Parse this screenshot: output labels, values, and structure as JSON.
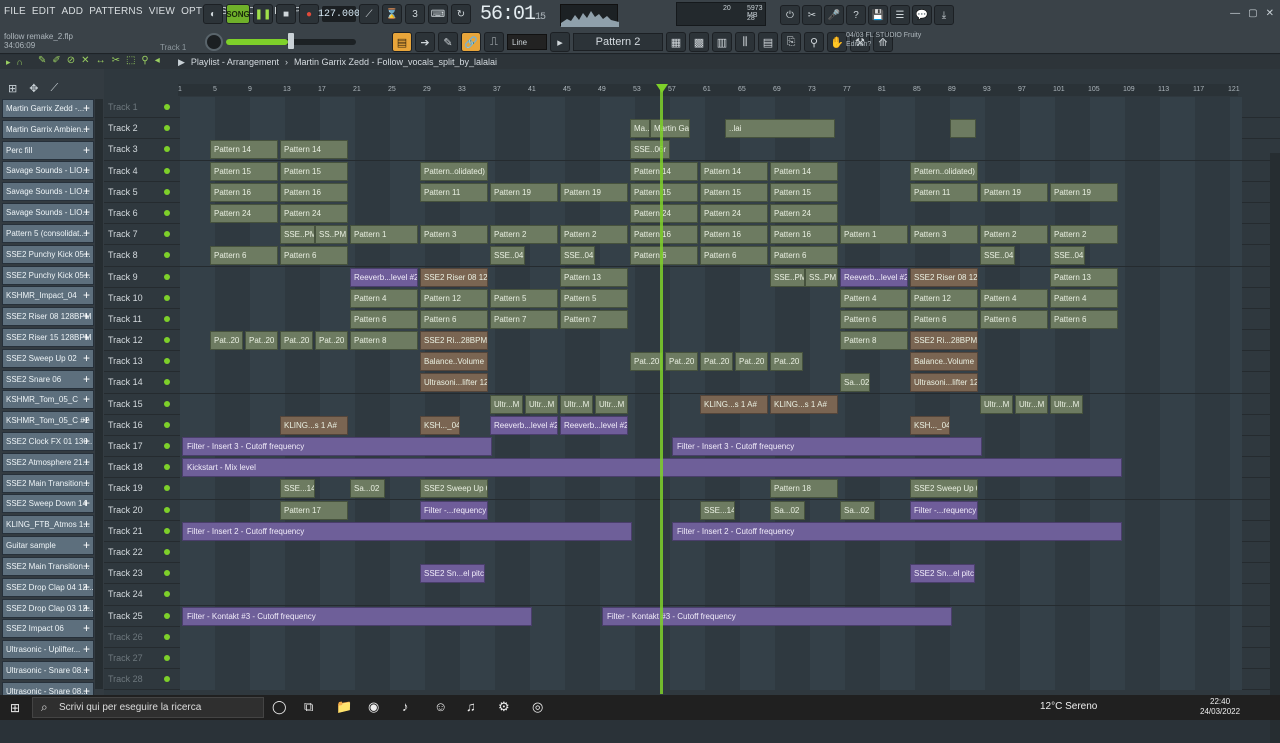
{
  "menu": [
    "FILE",
    "EDIT",
    "ADD",
    "PATTERNS",
    "VIEW",
    "OPTIONS",
    "TOOLS",
    "HELP"
  ],
  "project": {
    "file": "follow remake_2.flp",
    "time": "34:06:09",
    "track_hint": "Track 1"
  },
  "transport": {
    "song_label": "SONG",
    "tempo": "127.000",
    "clock": "56:01",
    "clock_sub": "15"
  },
  "cpu": {
    "a": "20",
    "b": "5973 MB",
    "c": "28"
  },
  "toolbar2": {
    "snap": "Line",
    "pattern": "Pattern 2"
  },
  "news": {
    "line1": "04/03  FL STUDIO Fruity",
    "line2": "Edition?"
  },
  "playlist": {
    "crumb": "Playlist - Arrangement",
    "sep": "›",
    "file": "Martin Garrix Zedd - Follow_vocals_split_by_lalalai"
  },
  "ruler": [
    "1",
    "5",
    "9",
    "13",
    "17",
    "21",
    "25",
    "29",
    "33",
    "37",
    "41",
    "45",
    "49",
    "53",
    "57",
    "61",
    "65",
    "69",
    "73",
    "77",
    "81",
    "85",
    "89",
    "93",
    "97",
    "101",
    "105",
    "109",
    "113",
    "117",
    "121"
  ],
  "channels": [
    "Martin Garrix Zedd -...",
    "Martin Garrix Ambien...",
    "Perc fill",
    "Savage Sounds - LIO...",
    "Savage Sounds - LIO...",
    "Savage Sounds - LIO...",
    "Pattern 5 (consolidat...",
    "SSE2 Punchy Kick 05...",
    "SSE2 Punchy Kick 05...",
    "KSHMR_Impact_04",
    "SSE2 Riser 08 128BPM",
    "SSE2 Riser 15 128BPM",
    "SSE2 Sweep Up 02",
    "SSE2 Snare 06",
    "KSHMR_Tom_05_C",
    "KSHMR_Tom_05_C #2",
    "SSE2 Clock FX 01 130...",
    "SSE2 Atmosphere 21...",
    "SSE2 Main Transition...",
    "SSE2 Sweep Down 14",
    "KLING_FTB_Atmos 1...",
    "Guitar sample",
    "SSE2 Main Transition...",
    "SSE2 Drop Clap 04 12...",
    "SSE2 Drop Clap 03 12...",
    "SSE2 Impact 06",
    "Ultrasonic - Uplifter...",
    "Ultrasonic - Snare 08...",
    "Ultrasonic - Snare 08..."
  ],
  "tracks": [
    "Track 1",
    "Track 2",
    "Track 3",
    "Track 4",
    "Track 5",
    "Track 6",
    "Track 7",
    "Track 8",
    "Track 9",
    "Track 10",
    "Track 11",
    "Track 12",
    "Track 13",
    "Track 14",
    "Track 15",
    "Track 16",
    "Track 17",
    "Track 18",
    "Track 19",
    "Track 20",
    "Track 21",
    "Track 22",
    "Track 23",
    "Track 24",
    "Track 25",
    "Track 26",
    "Track 27",
    "Track 28"
  ],
  "clips": {
    "t2": [
      "Ma..alalai",
      "Martin Garrix..._split_by_lalalai",
      "..lai"
    ],
    "t3": [
      "Pattern 14",
      "Pattern 14",
      "SSE..06r"
    ],
    "t4": [
      "Pattern 15",
      "Pattern 15",
      "Pattern..olidated)",
      "Pattern 14",
      "Pattern 14",
      "Pattern 14",
      "Pattern..olidated)"
    ],
    "t5": [
      "Pattern 16",
      "Pattern 16",
      "Pattern 11",
      "Pattern 19",
      "Pattern 19",
      "Pattern 15",
      "Pattern 15",
      "Pattern 15",
      "Pattern 11",
      "Pattern 19",
      "Pattern 19"
    ],
    "t6": [
      "Pattern 24",
      "Pattern 24",
      "Pattern 24",
      "Pattern 24",
      "Pattern 24"
    ],
    "t7": [
      "SSE..PM",
      "SS..PM",
      "Pattern 1",
      "Pattern 3",
      "Pattern 2",
      "Pattern 2",
      "Pattern 16",
      "Pattern 16",
      "Pattern 16",
      "Pattern 1",
      "Pattern 3",
      "Pattern 2",
      "Pattern 2"
    ],
    "t8": [
      "Pattern 6",
      "Pattern 6",
      "SSE..04",
      "SSE..04",
      "Pattern 6",
      "Pattern 6",
      "Pattern 6",
      "SSE..04",
      "SSE..04"
    ],
    "t9": [
      "Reeverb...level #2",
      "SSE2 Riser 08 128BPM",
      "Pattern 13",
      "SSE..PM",
      "SS..PM",
      "Reeverb...level #2",
      "SSE2 Riser 08 128BPM",
      "Pattern 13"
    ],
    "t10": [
      "Pattern 4",
      "Pattern 12",
      "Pattern 5",
      "Pattern 5",
      "Pattern 4",
      "Pattern 12",
      "Pattern 4",
      "Pattern 4"
    ],
    "t11": [
      "Pattern 6",
      "Pattern 6",
      "Pattern 7",
      "Pattern 7",
      "Pattern 6",
      "Pattern 6",
      "Pattern 6",
      "Pattern 6"
    ],
    "t12": [
      "Pat..20",
      "Pat..20",
      "Pat..20",
      "Pat..20",
      "Pattern 8",
      "SSE2 Ri...28BPM",
      "Pattern 8",
      "SSE2 Ri...28BPM"
    ],
    "t13": [
      "Balance..Volume",
      "Pat..20",
      "Pat..20",
      "Pat..20",
      "Pat..20",
      "Pat..20",
      "Balance..Volume"
    ],
    "t14": [
      "Ultrasoni...lifter 12",
      "Sa...02",
      "Ultrasoni...lifter 12"
    ],
    "t15": [
      "Ultr...M",
      "Ultr...M",
      "Ultr...M",
      "Ultr...M",
      "KLING...s 1 A#",
      "KLING...s 1 A#",
      "Ultr...M",
      "Ultr...M",
      "Ultr...M"
    ],
    "t16": [
      "KLING...s 1 A#",
      "KSH..._04",
      "Reeverb...level #2",
      "Reeverb...level #2",
      "KSH..._04"
    ],
    "t17": [
      "Filter - Insert 3 - Cutoff frequency",
      "Filter - Insert 3 - Cutoff frequency"
    ],
    "t18": [
      "Kickstart - Mix level"
    ],
    "t19": [
      "SSE...14",
      "Sa...02",
      "SSE2 Sweep Up 02",
      "Pattern 18",
      "SSE2 Sweep Up 02"
    ],
    "t20": [
      "Pattern 17",
      "Filter -...requency",
      "SSE...14",
      "Sa...02",
      "Sa...02",
      "Filter -...requency"
    ],
    "t21": [
      "Filter - Insert 2 - Cutoff frequency",
      "Filter - Insert 2 - Cutoff frequency"
    ],
    "t23": [
      "SSE2 Sn...el pitch",
      "SSE2 Sn...el pitch"
    ],
    "t25": [
      "Filter - Kontakt #3 - Cutoff frequency",
      "Filter - Kontakt #3 - Cutoff frequency"
    ]
  },
  "taskbar": {
    "search": "Scrivi qui per eseguire la ricerca",
    "weather": "12°C  Sereno",
    "time": "22:40",
    "date": "24/03/2022"
  }
}
